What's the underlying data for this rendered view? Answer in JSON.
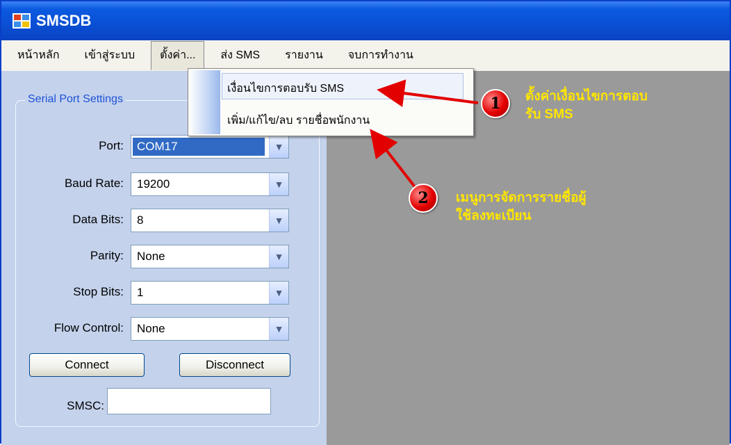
{
  "window": {
    "title": "SMSDB",
    "icon": "app-window-icon"
  },
  "menubar": {
    "items": [
      "หน้าหลัก",
      "เข้าสู่ระบบ",
      "ตั้งค่า...",
      "ส่ง SMS",
      "รายงาน",
      "จบการทำงาน"
    ],
    "active_index": 2
  },
  "dropdown": {
    "items": [
      "เงื่อนไขการตอบรับ SMS",
      "เพิ่ม/แก้ไข/ลบ รายชื่อพนักงาน"
    ]
  },
  "serial_settings": {
    "legend": "Serial Port Settings",
    "fields": [
      {
        "label": "Port:",
        "value": "COM17"
      },
      {
        "label": "Baud Rate:",
        "value": "19200"
      },
      {
        "label": "Data Bits:",
        "value": "8"
      },
      {
        "label": "Parity:",
        "value": "None"
      },
      {
        "label": "Stop Bits:",
        "value": "1"
      },
      {
        "label": "Flow Control:",
        "value": "None"
      }
    ],
    "connect_label": "Connect",
    "disconnect_label": "Disconnect",
    "smsc_label": "SMSC:",
    "smsc_value": ""
  },
  "annotations": [
    {
      "number": "1",
      "text_line1": "ตั้งค่าเงื่อนไขการตอบ",
      "text_line2": "รับ SMS"
    },
    {
      "number": "2",
      "text_line1": "เมนูการจัดการรายชื่อผู้",
      "text_line2": "ใช้ลงทะเบียน"
    }
  ],
  "colors": {
    "titlebar": "#0a4fd4",
    "accent": "#316ac5",
    "annotation_text": "#ffe600",
    "badge": "#e30000"
  }
}
